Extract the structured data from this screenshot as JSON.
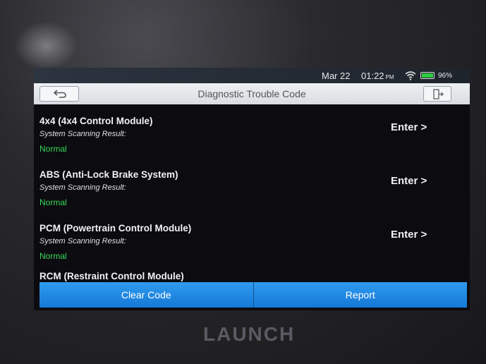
{
  "status_bar": {
    "date": "Mar 22",
    "time": "01:22",
    "ampm": "PM",
    "battery": "96%"
  },
  "header": {
    "title": "Diagnostic Trouble Code"
  },
  "rows": [
    {
      "name": "4x4 (4x4 Control Module)",
      "label": "System Scanning Result:",
      "status": "Normal",
      "action": "Enter >"
    },
    {
      "name": "ABS (Anti-Lock Brake System)",
      "label": "System Scanning Result:",
      "status": "Normal",
      "action": "Enter >"
    },
    {
      "name": "PCM (Powertrain Control Module)",
      "label": "System Scanning Result:",
      "status": "Normal",
      "action": "Enter >"
    },
    {
      "name": "RCM (Restraint Control Module)"
    }
  ],
  "footer": {
    "clear_code": "Clear Code",
    "report": "Report"
  },
  "device": {
    "brand": "LAUNCH"
  },
  "colors": {
    "status_normal": "#39d95a",
    "button_blue": "#1f8be6",
    "title_bar": "#e4e7ea"
  }
}
